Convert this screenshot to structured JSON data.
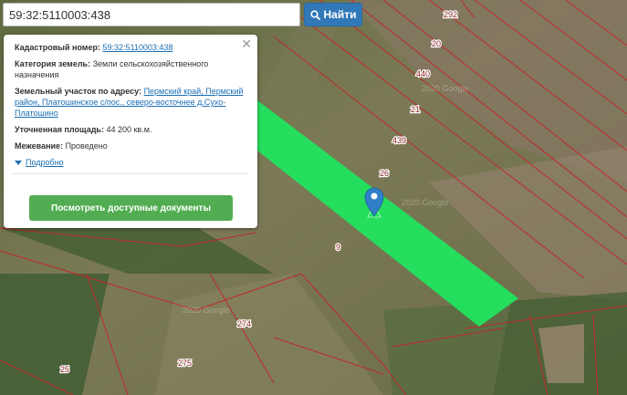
{
  "search": {
    "value": "59:32:5110003:438",
    "button_label": "Найти"
  },
  "popup": {
    "cadastral_label": "Кадастровый номер:",
    "cadastral_value": "59:32:5110003:438",
    "category_label": "Категория земель:",
    "category_value": "Земли сельскохозяйственного назначения",
    "address_label": "Земельный участок по адресу:",
    "address_value": "Пермский край, Пермский район, Платошинское с/пос., северо-восточнее д.Сухо-Платошино",
    "area_label": "Уточненная площадь:",
    "area_value": "44 200 кв.м.",
    "survey_label": "Межевание:",
    "survey_value": "Проведено",
    "more_label": "Подробно",
    "documents_button": "Посмотреть доступные документы",
    "close_icon": "close-icon"
  },
  "map": {
    "parcel_labels": [
      "292",
      "20",
      "440",
      "21",
      "439",
      "26",
      "9",
      "274",
      "275",
      "25"
    ],
    "watermark": "2020 Google",
    "colors": {
      "highlight": "#21e45f",
      "boundary": "#c0282c",
      "marker": "#2f7fc6"
    }
  }
}
